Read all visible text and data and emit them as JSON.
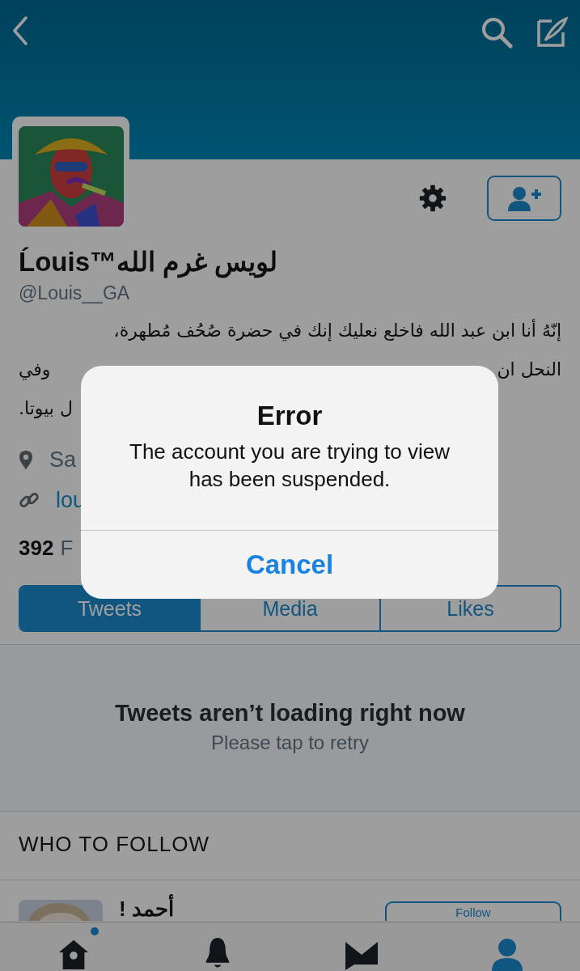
{
  "profile": {
    "name": "Ĺouis™لويس غرم الله",
    "handle": "@Louis__GA",
    "bio_lines": [
      {
        "right": "إنّهُ أنا ابن عبد الله فاخلع نعليك إنك في حضرة صُحُف مُطهرة،"
      },
      {
        "left": "وفي",
        "right": "النحل ان"
      },
      {
        "left": "ل بيوتا."
      }
    ],
    "location": "Sa",
    "link": "lou",
    "stats_count": "392",
    "stats_label": "F"
  },
  "tabs": [
    {
      "label": "Tweets",
      "selected": true
    },
    {
      "label": "Media",
      "selected": false
    },
    {
      "label": "Likes",
      "selected": false
    }
  ],
  "error_state": {
    "title": "Tweets aren’t loading right now",
    "subtitle": "Please tap to retry"
  },
  "who_to_follow": {
    "heading": "WHO TO FOLLOW",
    "suggestion": {
      "name": "أحمد !",
      "button": "Follow"
    }
  },
  "bottom_nav": [
    {
      "kind": "home",
      "selected": false,
      "badge": true
    },
    {
      "kind": "bell",
      "selected": false,
      "badge": false
    },
    {
      "kind": "mail",
      "selected": false,
      "badge": false
    },
    {
      "kind": "profile",
      "selected": true,
      "badge": false
    }
  ],
  "alert": {
    "title": "Error",
    "message": "The account you are trying to view has been suspended.",
    "button": "Cancel"
  }
}
